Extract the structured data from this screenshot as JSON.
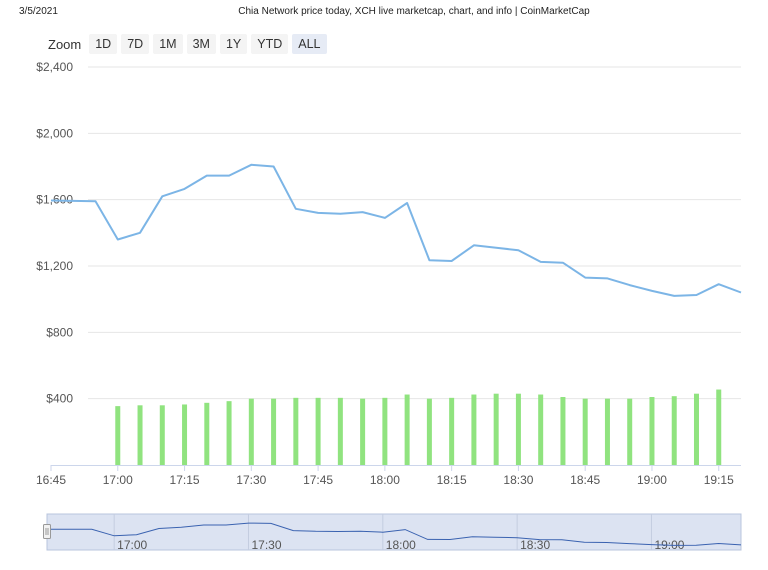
{
  "header": {
    "date": "3/5/2021",
    "title": "Chia Network price today, XCH live marketcap, chart, and info | CoinMarketCap"
  },
  "zoom": {
    "label": "Zoom",
    "buttons": [
      {
        "label": "1D",
        "active": false
      },
      {
        "label": "7D",
        "active": false
      },
      {
        "label": "1M",
        "active": false
      },
      {
        "label": "3M",
        "active": false
      },
      {
        "label": "1Y",
        "active": false
      },
      {
        "label": "YTD",
        "active": false
      },
      {
        "label": "ALL",
        "active": true
      }
    ]
  },
  "colors": {
    "price_line": "#7cb5e6",
    "volume_bar": "#90e37f",
    "grid": "#e6e6e6",
    "navigator_fill": "#dce3f2",
    "navigator_line": "#3a62b0",
    "axis_text": "#555555"
  },
  "chart_data": {
    "type": "line",
    "title": "",
    "xlabel": "",
    "ylabel": "",
    "ylim": [
      0,
      2400
    ],
    "y_ticks": [
      "$2,400",
      "$2,000",
      "$1,600",
      "$1,200",
      "$800",
      "$400"
    ],
    "y_tick_values": [
      2400,
      2000,
      1600,
      1200,
      800,
      400
    ],
    "x_ticks": [
      "16:45",
      "17:00",
      "17:15",
      "17:30",
      "17:45",
      "18:00",
      "18:15",
      "18:30",
      "18:45",
      "19:00",
      "19:15"
    ],
    "x_tick_values": [
      0,
      15,
      30,
      45,
      60,
      75,
      90,
      105,
      120,
      135,
      150
    ],
    "x_unit": "minutes after 16:45",
    "series": [
      {
        "type": "line",
        "x": [
          0,
          10,
          15,
          20,
          25,
          30,
          35,
          40,
          45,
          50,
          55,
          60,
          65,
          70,
          75,
          80,
          85,
          90,
          95,
          100,
          105,
          110,
          115,
          120,
          125,
          130,
          135,
          140,
          145,
          150,
          155
        ],
        "values": [
          1595,
          1590,
          1360,
          1400,
          1620,
          1665,
          1745,
          1745,
          1810,
          1800,
          1545,
          1520,
          1515,
          1525,
          1490,
          1580,
          1235,
          1230,
          1325,
          1310,
          1295,
          1225,
          1220,
          1130,
          1125,
          1085,
          1050,
          1020,
          1025,
          1090,
          1040
        ]
      },
      {
        "type": "bar",
        "x": [
          15,
          20,
          25,
          30,
          35,
          40,
          45,
          50,
          55,
          60,
          65,
          70,
          75,
          80,
          85,
          90,
          95,
          100,
          105,
          110,
          115,
          120,
          125,
          130,
          135,
          140,
          145,
          150
        ],
        "values": [
          355,
          360,
          360,
          365,
          375,
          385,
          400,
          400,
          405,
          405,
          405,
          400,
          405,
          425,
          400,
          405,
          425,
          430,
          430,
          425,
          410,
          400,
          400,
          400,
          410,
          415,
          430,
          455
        ]
      }
    ],
    "navigator": {
      "x_ticks": [
        "17:00",
        "17:30",
        "18:00",
        "18:30",
        "19:00"
      ],
      "x_tick_values": [
        15,
        45,
        75,
        105,
        135
      ]
    }
  }
}
